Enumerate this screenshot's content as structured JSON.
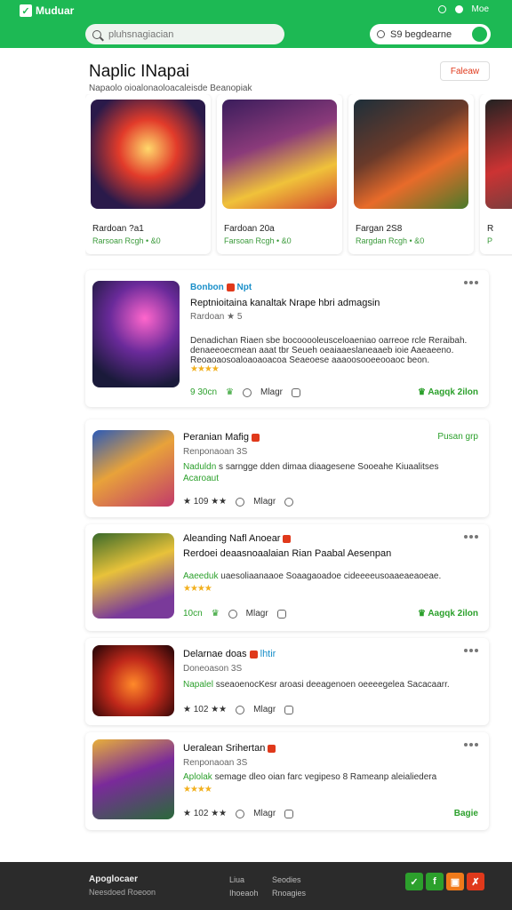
{
  "header": {
    "brand": "Muduar",
    "top_icon_label": "Moe",
    "search_placeholder": "pluhsnagiacian",
    "search2_text": "S9 begdearne"
  },
  "section": {
    "title": "Naplic INapai",
    "subtitle": "Napaolo oioalonaoloacaleisde Beanopiak",
    "view_all": "Faleaw"
  },
  "featured": [
    {
      "title": "Rardoan ?a1",
      "meta": "Rarsoan Rcgh • &0",
      "colors": [
        "#2a1a4a",
        "#e23b2a",
        "#f5a623"
      ]
    },
    {
      "title": "Fardoan 20a",
      "meta": "Farsoan Rcgh • &0",
      "colors": [
        "#3a1d5c",
        "#f0c23a",
        "#d2452f"
      ]
    },
    {
      "title": "Fargan 2S8",
      "meta": "Rargdan Rcgh • &0",
      "colors": [
        "#1d2f3a",
        "#e86b2a",
        "#4a7a2a"
      ]
    },
    {
      "title": "R",
      "meta": "P",
      "colors": [
        "#222",
        "#c33",
        "#444"
      ]
    }
  ],
  "items": [
    {
      "badge_text": "Bonbon",
      "badge_tag": "Npt",
      "title": "Reptnioitaina kanaltak Nrape hbri admagsin",
      "sub": "Rardoan ★ 5",
      "desc1": "Denadichan Riaen sbe bocooooleusceloaeniao oarreoe rcle Reraibah.",
      "desc2": "denaeeoecmean aaat tbr Seueh oeaiaaeslaneaaeb ioie Aaeaeeno.",
      "desc3": "Reoaoaosoaloaoaoacoa Seaeoese aaaoosooeeooaoc beon.",
      "rating": "★★★★",
      "stat1": "9 30cn",
      "stat2": "Mlagr",
      "stat3": "0",
      "cta": "Aagqk 2ilon"
    },
    {
      "title": "Peranian Mafig",
      "sub": "Renponaoan 3S",
      "desc_lead": "Naduldn",
      "desc": "s sarngge dden dimaa diaagesene Sooeahe Kiuaalitses",
      "desc2": "Acaroaut",
      "rating_text": "★ 109 ★★",
      "stat2": "Mlagr",
      "stat3": "0",
      "cta": "Pusan grp"
    },
    {
      "title": "Aleanding Nafl Anoear",
      "sub": "Rerdoei deaasnoaalaian Rian Paabal Aesenpan",
      "desc_lead": "Aaeeduk",
      "desc": "uaesoliaanaaoe Soaagaoadoe cideeeeusoaaeaeaoeae.",
      "rating": "★★★★",
      "stat1": "10cn",
      "stat2": "Mlagr",
      "stat3": "0",
      "cta": "Aagqk 2ilon"
    },
    {
      "title": "Delarnae doas",
      "title_tag": "lhtir",
      "sub": "Doneoason 3S",
      "desc_lead": "Napalel",
      "desc": "sseaoenocKesr aroasi deeagenoen oeeeegelea Sacacaarr.",
      "rating_text": "★ 102 ★★",
      "stat2": "Mlagr",
      "stat3": "0"
    },
    {
      "title": "Ueralean Srihertan",
      "sub": "Renponaoan 3S",
      "desc_lead": "Aplolak",
      "desc": "semage dleo oian farc vegipeso 8 Rameanp aleialiedera",
      "rating": "★★★★",
      "rating_text": "★ 102 ★★",
      "stat2": "Mlagr",
      "stat3": "0",
      "cta": "Bagie"
    }
  ],
  "footer": {
    "brand": "Apoglocaer",
    "sub": "Neesdoed Roeoon",
    "col1a": "Liua",
    "col1b": "Ihoeaoh",
    "col2a": "Seodies",
    "col2b": "Rnoagies",
    "social": [
      "✓",
      "f",
      "▣",
      "✗"
    ]
  }
}
